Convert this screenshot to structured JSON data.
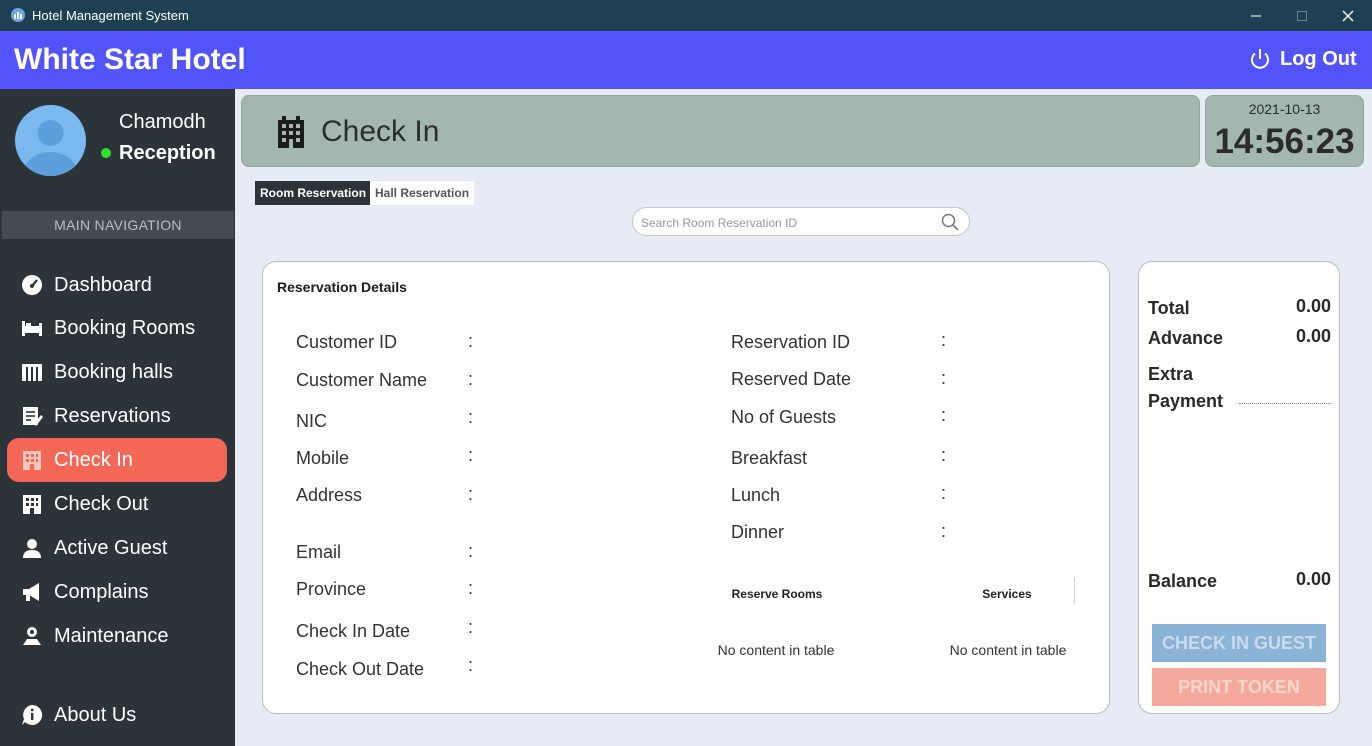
{
  "window": {
    "title": "Hotel Management System"
  },
  "header": {
    "hotel_name": "White Star Hotel",
    "logout_label": "Log Out"
  },
  "user": {
    "name": "Chamodh",
    "role": "Reception"
  },
  "sidebar": {
    "nav_header": "MAIN NAVIGATION",
    "items": [
      {
        "label": "Dashboard"
      },
      {
        "label": "Booking Rooms"
      },
      {
        "label": "Booking halls"
      },
      {
        "label": "Reservations"
      },
      {
        "label": "Check In"
      },
      {
        "label": "Check Out"
      },
      {
        "label": "Active Guest"
      },
      {
        "label": "Complains"
      },
      {
        "label": "Maintenance"
      },
      {
        "label": "About Us"
      }
    ],
    "active_item": "Check In"
  },
  "page": {
    "title": "Check In"
  },
  "clock": {
    "date": "2021-10-13",
    "time": "14:56:23"
  },
  "tabs": [
    {
      "label": "Room Reservation",
      "active": true
    },
    {
      "label": "Hall Reservation",
      "active": false
    }
  ],
  "search": {
    "placeholder": "Search Room Reservation ID",
    "value": ""
  },
  "reservation": {
    "title": "Reservation Details",
    "separator": ":",
    "left_fields": [
      {
        "label": "Customer ID",
        "value": ""
      },
      {
        "label": "Customer Name",
        "value": ""
      },
      {
        "label": "NIC",
        "value": ""
      },
      {
        "label": "Mobile",
        "value": ""
      },
      {
        "label": "Address",
        "value": ""
      },
      {
        "label": "Email",
        "value": ""
      },
      {
        "label": "Province",
        "value": ""
      },
      {
        "label": "Check In Date",
        "value": ""
      },
      {
        "label": "Check Out Date",
        "value": ""
      }
    ],
    "right_fields": [
      {
        "label": "Reservation ID",
        "value": ""
      },
      {
        "label": "Reserved Date",
        "value": ""
      },
      {
        "label": "No of Guests",
        "value": ""
      },
      {
        "label": "Breakfast",
        "value": ""
      },
      {
        "label": "Lunch",
        "value": ""
      },
      {
        "label": "Dinner",
        "value": ""
      }
    ],
    "tables": [
      {
        "header": "Reserve Rooms",
        "empty_text": "No content in table"
      },
      {
        "header": "Services",
        "empty_text": "No content in table"
      }
    ]
  },
  "payment": {
    "total_label": "Total",
    "total_value": "0.00",
    "advance_label": "Advance",
    "advance_value": "0.00",
    "extra_label_1": "Extra",
    "extra_label_2": "Payment",
    "balance_label": "Balance",
    "balance_value": "0.00",
    "checkin_button": "CHECK IN GUEST",
    "print_button": "PRINT TOKEN"
  },
  "colors": {
    "header": "#5353fa",
    "sidebar": "#2c3439",
    "active_nav": "#f26756",
    "banner": "#a4b7ae",
    "online": "#30e030"
  },
  "icons": {
    "titlebar": "hotel-app-icon",
    "logout": "power-icon",
    "nav": [
      "gauge-icon",
      "bed-icon",
      "hall-icon",
      "edit-icon",
      "building-icon",
      "building-icon",
      "user-icon",
      "megaphone-icon",
      "maintenance-icon",
      "info-icon"
    ],
    "search": "search-icon"
  }
}
